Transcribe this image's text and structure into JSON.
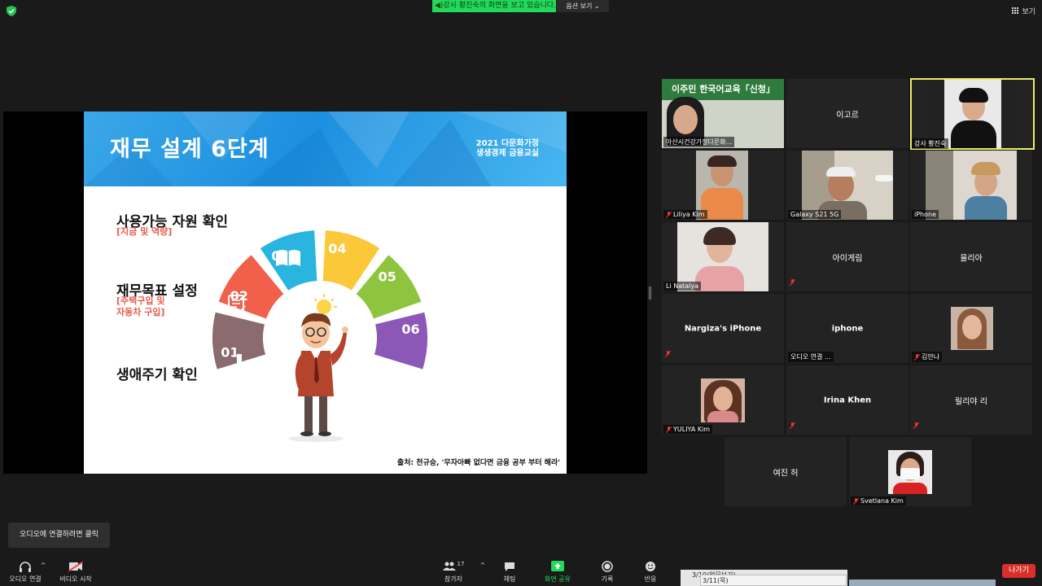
{
  "top": {
    "share_banner": "◀)강사 황진숙의 화면을 보고 있습니다.",
    "view_options": "옵션 보기 ⌄",
    "grid_view": "보기"
  },
  "slide": {
    "title": "재무 설계 6단계",
    "subtitle_line1": "2021 다문화가정",
    "subtitle_line2": "생생경제 금융교실",
    "steps": [
      {
        "label": "사용가능 자원 확인",
        "sub": "[지금 및 역량]"
      },
      {
        "label": "재무목표 설정",
        "sub1": "[주택구입 및",
        "sub2": "자동차 구입]"
      },
      {
        "label": "생애주기 확인"
      }
    ],
    "segments": [
      {
        "num": "01",
        "color": "#8b6b6e"
      },
      {
        "num": "02",
        "color": "#f0604b"
      },
      {
        "num": "03",
        "color": "#29b5e0"
      },
      {
        "num": "04",
        "color": "#fbc83a"
      },
      {
        "num": "05",
        "color": "#8fc43f"
      },
      {
        "num": "06",
        "color": "#8c58b8"
      }
    ],
    "source_note": "출처: 천규승, '무자아빠 없다면 금융 공부 부터 해라'"
  },
  "tiles": [
    {
      "name": "아산시건강가정다문화...",
      "banner": "이주민 한국어교육「신청」"
    },
    {
      "name": "이고르"
    },
    {
      "name": "강사 황진숙"
    },
    {
      "name": "Liliya Kim"
    },
    {
      "name": "Galaxy S21 5G"
    },
    {
      "name": "iPhone"
    },
    {
      "name": "Li Natalya"
    },
    {
      "name": "아이게림"
    },
    {
      "name": "율리아"
    },
    {
      "name": "Nargiza's iPhone"
    },
    {
      "name": "iphone",
      "label": "오디오 연결 ..."
    },
    {
      "name": "김안나"
    },
    {
      "name": "YULIYA Kim"
    },
    {
      "name": "Irina Khen"
    },
    {
      "name": "릴리야 리"
    },
    {
      "name": "여진 허"
    },
    {
      "name": "Svetlana Kim"
    }
  ],
  "toolbar": {
    "tooltip": "오디오에 연결하려면 클릭",
    "audio": "오디오 연결",
    "video": "비디오 시작",
    "participants": "참가자",
    "participants_count": "17",
    "chat": "채팅",
    "share": "화면 공유",
    "record": "기록",
    "reactions": "반응",
    "leave": "나가기"
  },
  "taskbar": {
    "item1": "3/10(업무보기)",
    "item2": "3/11(목)"
  }
}
